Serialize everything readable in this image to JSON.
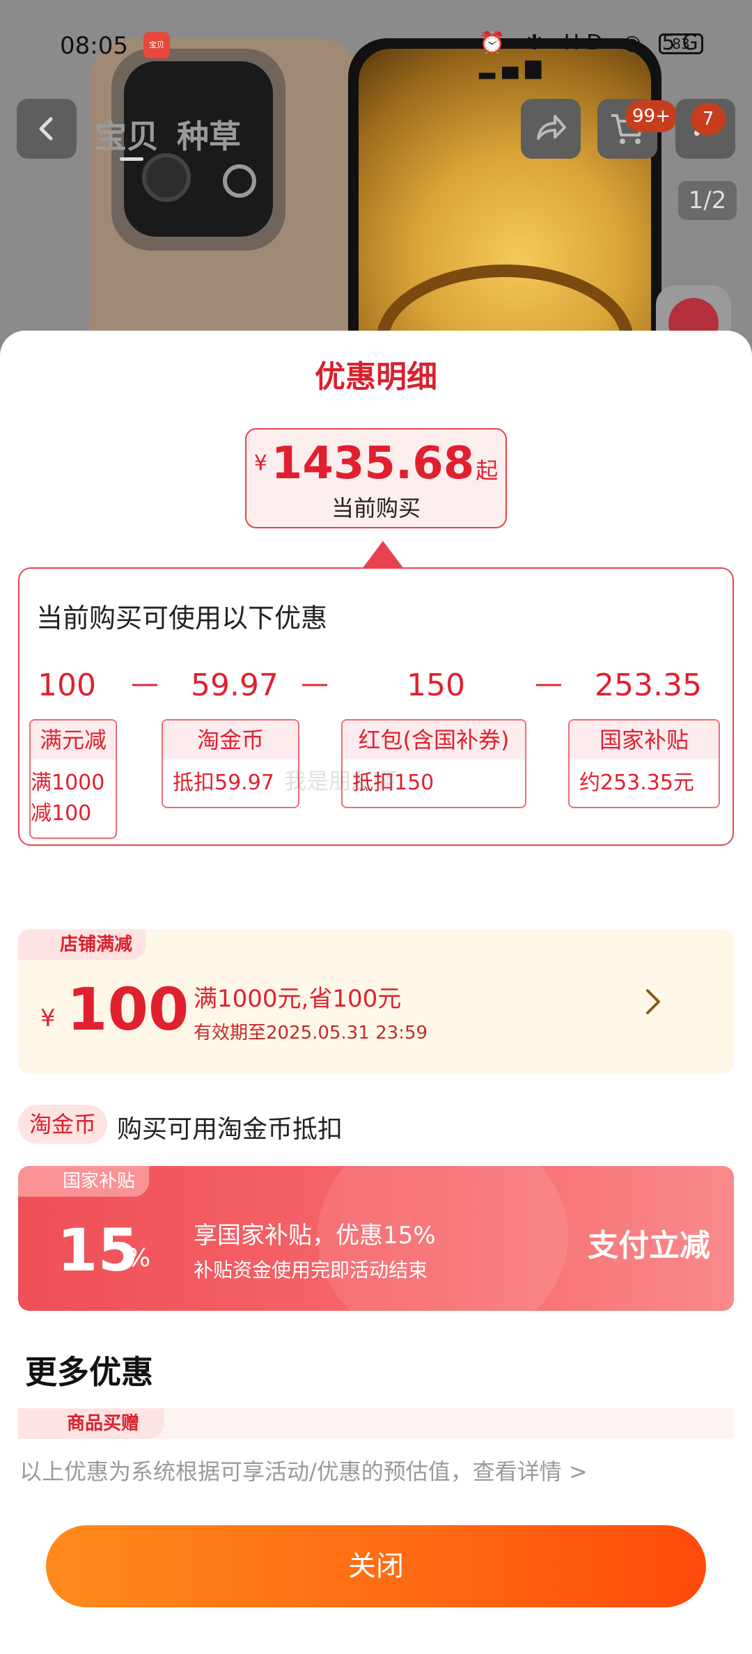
{
  "status_bar": {
    "time": "08:05",
    "app_icon_label": "宝贝",
    "icons": "⏰ ✱ HD ◉ 5G ▂▄▆",
    "battery": "83"
  },
  "nav": {
    "tabs": [
      "宝贝",
      "种草"
    ],
    "cart_badge": "99+",
    "more_badge": "7",
    "image_counter": "1/2"
  },
  "sheet": {
    "title": "优惠明细",
    "price": {
      "currency": "¥",
      "value": "1435.68",
      "suffix": "起",
      "label": "当前购买"
    },
    "discounts_heading": "当前购买可使用以下优惠",
    "amounts": [
      "100",
      "59.97",
      "150",
      "253.35"
    ],
    "separator": "—",
    "chips": [
      {
        "title": "满元减",
        "desc_line1": "满1000",
        "desc_line2": "减100"
      },
      {
        "title": "淘金币",
        "desc_line1": "抵扣59.97"
      },
      {
        "title": "红包(含国补券)",
        "desc_line1": "抵扣150"
      },
      {
        "title": "国家补贴",
        "desc_line1": "约253.35元"
      }
    ],
    "watermark": "我是朋友啊"
  },
  "shop_coupon": {
    "tag": "店铺满减",
    "currency": "¥",
    "value": "100",
    "rule": "满1000元,省100元",
    "validity": "有效期至2025.05.31 23:59"
  },
  "taojinbi": {
    "tag": "淘金币",
    "text": "购买可用淘金币抵扣"
  },
  "gov_coupon": {
    "tag": "国家补贴",
    "percent": "15",
    "percent_sign": "%",
    "title": "享国家补贴，优惠15%",
    "subtitle": "补贴资金使用完即活动结束",
    "action": "支付立减"
  },
  "more": {
    "title": "更多优惠",
    "gift_tag": "商品买赠"
  },
  "footnote": "以上优惠为系统根据可享活动/优惠的预估值，查看详情 >",
  "close_button": "关闭",
  "colors": {
    "accent_red": "#e0202f",
    "close_orange": "#ff6812",
    "gov_red": "#ef4f56"
  }
}
